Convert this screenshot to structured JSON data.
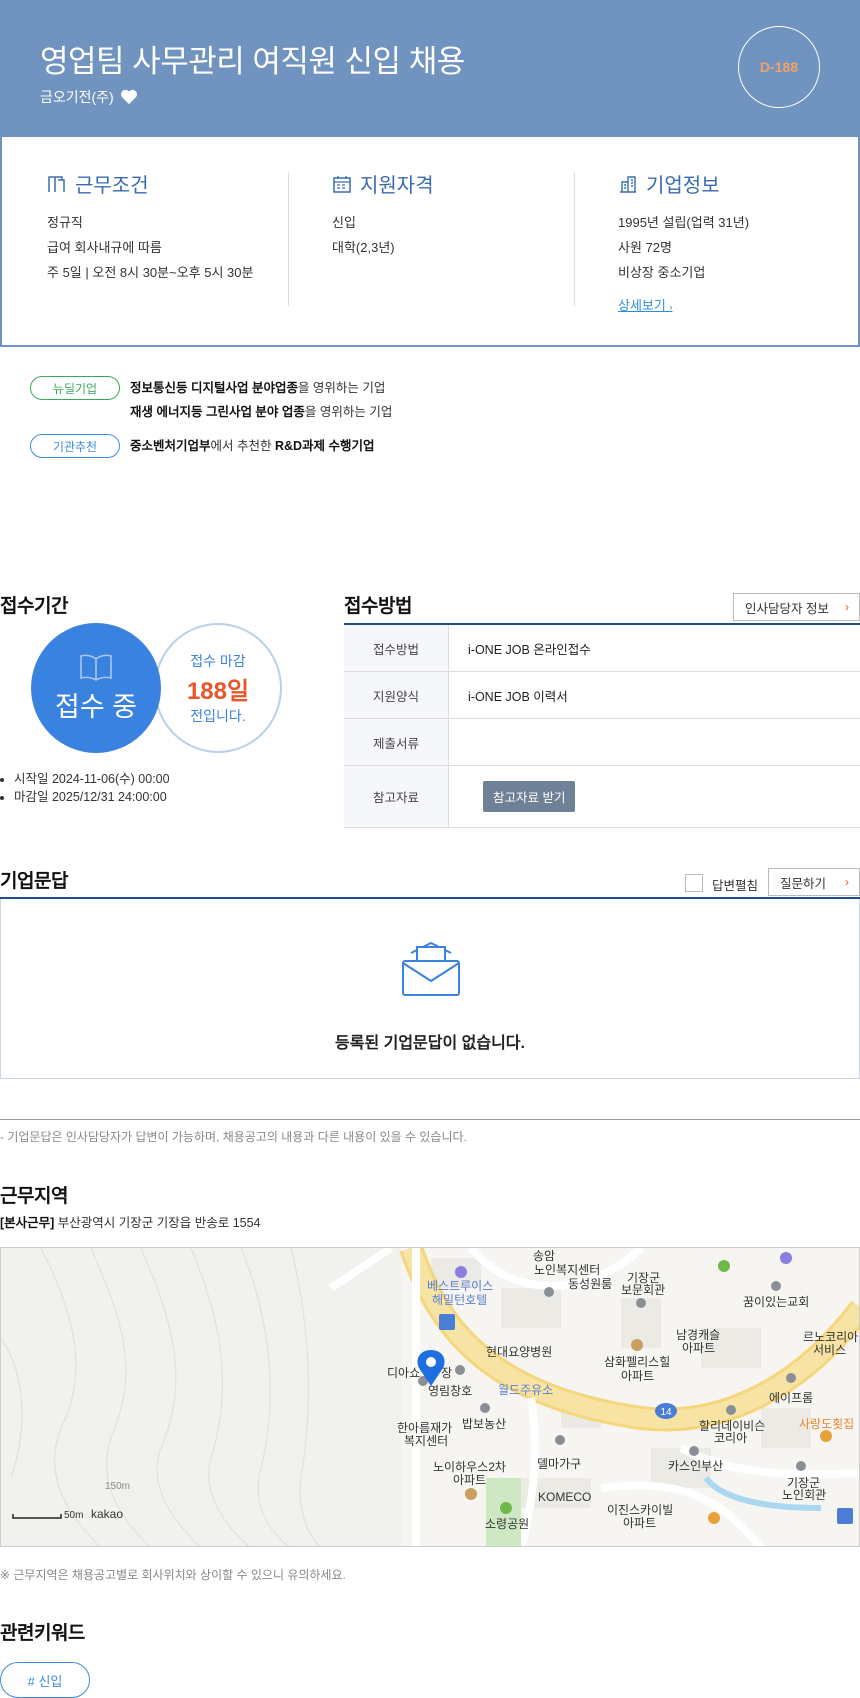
{
  "header": {
    "title": "영업팀 사무관리 여직원 신입 채용",
    "company": "금오기전(주)",
    "dday": "D-188"
  },
  "conditions": {
    "title": "근무조건",
    "lines": [
      "정규직",
      "급여 회사내규에 따름",
      "주 5일 | 오전 8시 30분~오후 5시 30분"
    ]
  },
  "qualifications": {
    "title": "지원자격",
    "lines": [
      "신입",
      "대학(2,3년)"
    ]
  },
  "company_info": {
    "title": "기업정보",
    "lines": [
      "1995년 설립(업력 31년)",
      "사원 72명",
      "비상장 중소기업"
    ],
    "more": "상세보기"
  },
  "tags": [
    {
      "label": "뉴딜기업",
      "color": "#3aa85c",
      "lines": [
        {
          "bold": "정보통신등 디지털사업 분야업종",
          "rest": "을 영위하는 기업"
        },
        {
          "bold": "재생 에너지등 그린사업 분야 업종",
          "rest": "을 영위하는 기업"
        }
      ]
    },
    {
      "label": "기관추천",
      "color": "#3d8ee0",
      "lines": [
        {
          "bold": "중소벤처기업부",
          "rest": "에서 추천한 ",
          "bold2": "R&D과제 수행기업"
        }
      ]
    }
  ],
  "period": {
    "title": "접수기간",
    "status": "접수 중",
    "deadline_line1": "접수 마감",
    "deadline_days": "188일",
    "deadline_line3": "전입니다.",
    "start": "시작일 2024-11-06(수) 00:00",
    "end": "마감일 2025/12/31 24:00:00"
  },
  "method": {
    "title": "접수방법",
    "hr_button": "인사담당자 정보",
    "rows": [
      {
        "th": "접수방법",
        "td": "i-ONE JOB 온라인접수"
      },
      {
        "th": "지원양식",
        "td": "i-ONE JOB 이력서"
      },
      {
        "th": "제출서류",
        "td": ""
      },
      {
        "th": "참고자료",
        "button": "참고자료 받기"
      }
    ]
  },
  "qa": {
    "title": "기업문답",
    "checkbox_label": "답변펼침",
    "ask_button": "질문하기",
    "empty": "등록된 기업문답이 없습니다.",
    "note": "- 기업문답은 인사담당자가 답변이 가능하며, 채용공고의 내용과 다른 내용이 있을 수 있습니다."
  },
  "location": {
    "title": "근무지역",
    "addr_tag": "[본사근무]",
    "addr": " 부산광역시 기장군 기장읍 반송로 1554",
    "note": "※ 근무지역은 채용공고별로 회사위치와 상이할 수 있으니 유의하세요.",
    "map_labels": [
      "송암",
      "노인복지센터",
      "동성원룸",
      "기장군",
      "보문회관",
      "베스트루이스",
      "해밀턴호텔",
      "꿈이있는교회",
      "남경캐슬",
      "아파트",
      "르노코리아",
      "서비스",
      "현대요양병원",
      "삼화펠리스힐",
      "아파트",
      "디아쇼",
      "장",
      "영림창호",
      "월드주유소",
      "에이프롬",
      "한아름재가",
      "복지센터",
      "밥보농산",
      "할리데이비슨",
      "코리아",
      "사랑도횟집",
      "노이하우스2차",
      "아파트",
      "델마가구",
      "카스인부산",
      "기장군",
      "노인회관",
      "KOMECO",
      "이진스카이빌",
      "아파트",
      "소령공원",
      "150m",
      "50m",
      "kakao",
      "14"
    ]
  },
  "keywords": {
    "title": "관련키워드",
    "items": [
      "# 신입"
    ]
  }
}
